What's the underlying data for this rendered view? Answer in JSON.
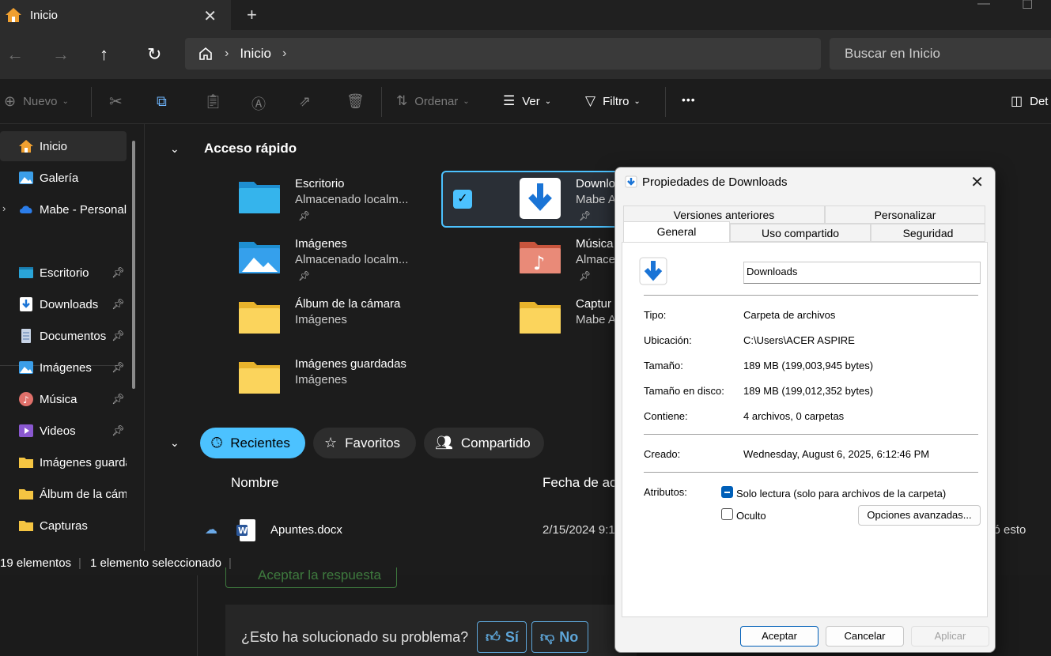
{
  "tabbar": {
    "tab_title": "Inicio",
    "close": "✕",
    "new_tab": "+"
  },
  "navbar": {
    "breadcrumb": [
      "Inicio"
    ],
    "search_placeholder": "Buscar en Inicio"
  },
  "toolbar": {
    "new_label": "Nuevo",
    "sort_label": "Ordenar",
    "view_label": "Ver",
    "filter_label": "Filtro",
    "more_label": "•••",
    "details_label": "Det"
  },
  "sidebar": {
    "items": [
      {
        "label": "Inicio",
        "icon": "home-icon"
      },
      {
        "label": "Galería",
        "icon": "gallery-icon"
      },
      {
        "label": "Mabe - Personal",
        "icon": "cloud-icon"
      },
      {
        "label": "Escritorio",
        "icon": "desktop-icon",
        "pinned": true
      },
      {
        "label": "Downloads",
        "icon": "download-icon",
        "pinned": true
      },
      {
        "label": "Documentos",
        "icon": "document-icon",
        "pinned": true
      },
      {
        "label": "Imágenes",
        "icon": "pictures-icon",
        "pinned": true
      },
      {
        "label": "Música",
        "icon": "music-icon",
        "pinned": true
      },
      {
        "label": "Videos",
        "icon": "video-icon",
        "pinned": true
      },
      {
        "label": "Imágenes guarda",
        "icon": "folder-icon"
      },
      {
        "label": "Álbum de la cám",
        "icon": "folder-icon"
      },
      {
        "label": "Capturas",
        "icon": "folder-icon"
      }
    ]
  },
  "quick_access": {
    "title": "Acceso rápido",
    "items": [
      {
        "name": "Escritorio",
        "sub": "Almacenado localm...",
        "pinned": true
      },
      {
        "name": "Downlo",
        "sub": "Mabe A",
        "pinned": true
      },
      {
        "name": "Imágenes",
        "sub": "Almacenado localm...",
        "pinned": true
      },
      {
        "name": "Música",
        "sub": "Almace",
        "pinned": true
      },
      {
        "name": "Álbum de la cámara",
        "sub": "Imágenes"
      },
      {
        "name": "Captur",
        "sub": "Mabe A"
      },
      {
        "name": "Imágenes guardadas",
        "sub": "Imágenes"
      }
    ]
  },
  "recent": {
    "pills": [
      "Recientes",
      "Favoritos",
      "Compartido"
    ],
    "columns": [
      "Nombre",
      "Fecha de ac"
    ],
    "files": [
      {
        "name": "Apuntes.docx",
        "date": "2/15/2024 9:1",
        "activity": "itó esto"
      }
    ]
  },
  "status": {
    "count": "19 elementos",
    "selected": "1 elemento seleccionado"
  },
  "web": {
    "accept": "Aceptar la respuesta",
    "question": "¿Esto ha solucionado su problema?",
    "yes": "Sí",
    "no": "No"
  },
  "dialog": {
    "title": "Propiedades de Downloads",
    "tabs_top": [
      "Versiones anteriores",
      "Personalizar"
    ],
    "tabs_bottom": [
      "General",
      "Uso compartido",
      "Seguridad"
    ],
    "folder_name": "Downloads",
    "rows": [
      {
        "label": "Tipo:",
        "value": "Carpeta de archivos"
      },
      {
        "label": "Ubicación:",
        "value": "C:\\Users\\ACER ASPIRE"
      },
      {
        "label": "Tamaño:",
        "value": "189 MB (199,003,945 bytes)"
      },
      {
        "label": "Tamaño en disco:",
        "value": "189 MB (199,012,352 bytes)"
      },
      {
        "label": "Contiene:",
        "value": "4 archivos, 0 carpetas"
      }
    ],
    "created_label": "Creado:",
    "created_value": "Wednesday, August 6, 2025, 6:12:46 PM",
    "attributes_label": "Atributos:",
    "readonly_label": "Solo lectura (solo para archivos de la carpeta)",
    "hidden_label": "Oculto",
    "advanced_label": "Opciones avanzadas...",
    "ok_label": "Aceptar",
    "cancel_label": "Cancelar",
    "apply_label": "Aplicar"
  }
}
